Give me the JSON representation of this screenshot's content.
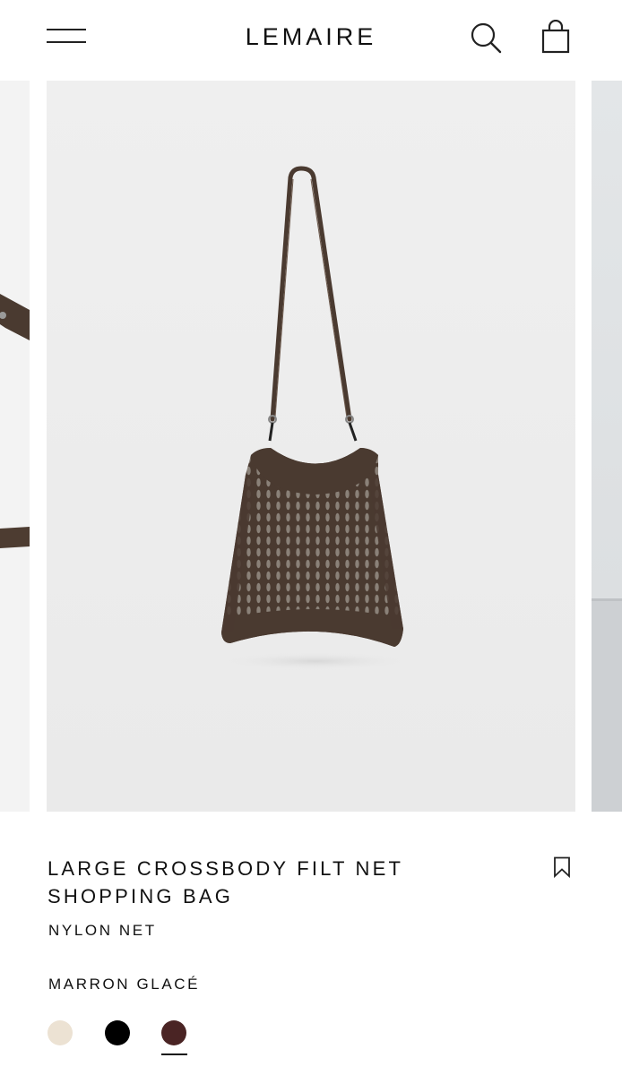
{
  "header": {
    "brand": "LEMAIRE",
    "icons": {
      "menu": "menu-icon",
      "search": "search-icon",
      "cart": "shopping-bag-icon"
    }
  },
  "product": {
    "title": "LARGE CROSSBODY FILT NET SHOPPING BAG",
    "material": "NYLON NET",
    "color_name": "MARRON GLACÉ",
    "swatches": [
      {
        "color": "#ece2d3",
        "selected": false
      },
      {
        "color": "#000000",
        "selected": false
      },
      {
        "color": "#4a2424",
        "selected": true
      }
    ],
    "bookmark_icon": "bookmark-icon",
    "bag_color": "#4a3a30"
  }
}
